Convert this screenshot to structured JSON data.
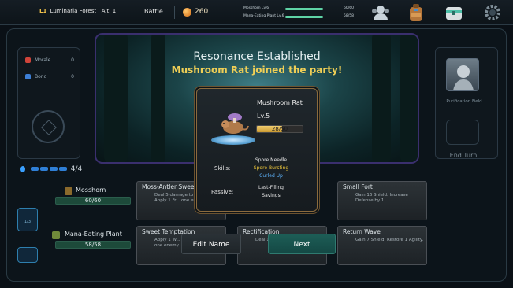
{
  "topbar": {
    "floor": "L1",
    "location": "Luminaria Forest",
    "altitude": "Alt. 1",
    "mode": "Battle",
    "coins": "260",
    "party_hp": [
      {
        "name": "Mosshorn Lv.6",
        "value": "60/60",
        "fraction": 1.0
      },
      {
        "name": "Mana-Eating Plant Lv.6",
        "value": "58/58",
        "fraction": 1.0
      }
    ],
    "icons": [
      "party-icon",
      "backpack-icon",
      "chest-icon",
      "settings-gear-icon"
    ]
  },
  "left_panel": {
    "stats": [
      {
        "label": "Morale",
        "value": "0",
        "color": "#d0443a"
      },
      {
        "label": "Bond",
        "value": "0",
        "color": "#3d7fd6"
      }
    ]
  },
  "right_panel": {
    "field_label": "Purification Field",
    "end_turn": "End Turn"
  },
  "scene": {
    "title": "Resonance Established",
    "subtitle": "Mushroom Rat joined the party!"
  },
  "energy": {
    "value": "4/4"
  },
  "party": [
    {
      "name": "Mosshorn",
      "hp": "60/60"
    },
    {
      "name": "Mana-Eating Plant",
      "hp": "58/58"
    }
  ],
  "nav": {
    "page": "1/3"
  },
  "cards": [
    {
      "title": "Moss-Antler Sweep",
      "desc": "Deal 5 damage to each enemy. Apply 1 Fr... one enemy."
    },
    {
      "title": "Small Fort",
      "desc": "Gain 16 Shield. Increase Defense by 1."
    },
    {
      "title": "Sweet Temptation",
      "desc": "Apply 1 W... enemy. Apply ... one enemy."
    },
    {
      "title": "Rectification",
      "desc": "Deal 1... twice."
    },
    {
      "title": "Return Wave",
      "desc": "Gain 7 Shield. Restore 1 Agility."
    }
  ],
  "modal": {
    "name": "Mushroom Rat",
    "level": "Lv.5",
    "exp": "28/50",
    "exp_fraction": 0.56,
    "skills_label": "Skills:",
    "skills": [
      {
        "name": "Spore Needle",
        "color": "#e6e6e6"
      },
      {
        "name": "Spore-Bursting",
        "color": "#f0c93a"
      },
      {
        "name": "Curled Up",
        "color": "#5fb6ff"
      }
    ],
    "passive_label": "Passive:",
    "passive": [
      "Last-Filling",
      "Savings"
    ]
  },
  "buttons": {
    "edit_name": "Edit Name",
    "next": "Next"
  }
}
